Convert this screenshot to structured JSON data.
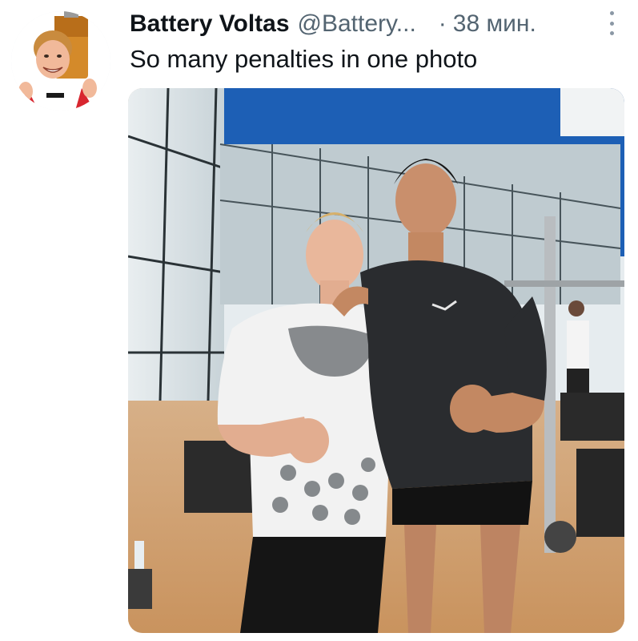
{
  "tweet": {
    "author_name": "Battery Voltas",
    "author_handle": "@Battery...",
    "separator": "·",
    "time": "38 мин.",
    "text": "So many penalties in one photo",
    "more_icon": "vertical-ellipsis-icon"
  },
  "colors": {
    "text_primary": "#0f1419",
    "text_secondary": "#536471"
  }
}
